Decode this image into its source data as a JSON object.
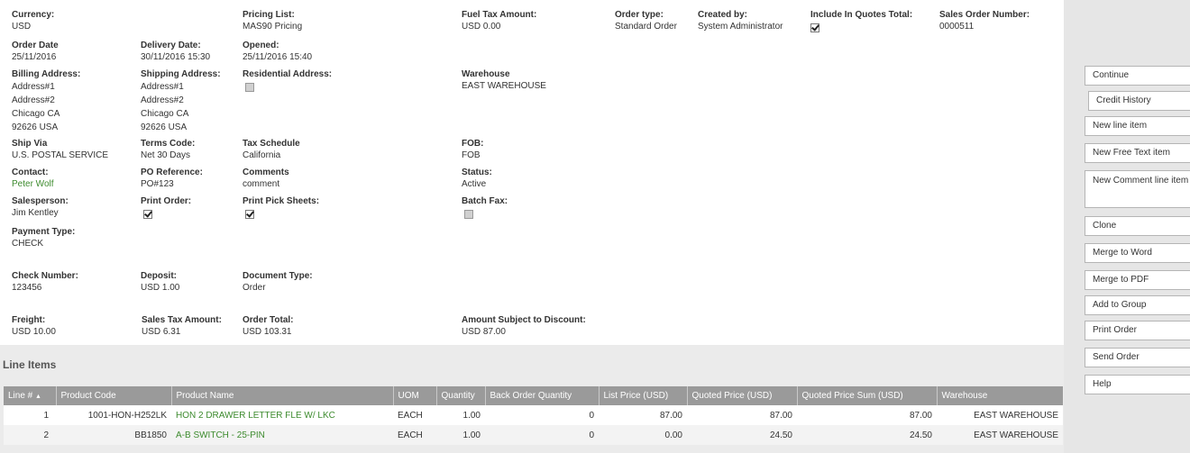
{
  "fields": {
    "currency": {
      "label": "Currency:",
      "value": "USD"
    },
    "pricing_list": {
      "label": "Pricing List:",
      "value": "MAS90 Pricing"
    },
    "fuel_tax": {
      "label": "Fuel Tax Amount:",
      "value": "USD 0.00"
    },
    "order_type": {
      "label": "Order type:",
      "value": "Standard Order"
    },
    "created_by": {
      "label": "Created by:",
      "value": "System Administrator"
    },
    "include_quotes": {
      "label": "Include In Quotes Total:",
      "checked": true
    },
    "sales_order_number": {
      "label": "Sales Order Number:",
      "value": "0000511"
    },
    "order_date": {
      "label": "Order Date",
      "value": "25/11/2016"
    },
    "delivery_date": {
      "label": "Delivery Date:",
      "value": "30/11/2016 15:30"
    },
    "opened": {
      "label": "Opened:",
      "value": "25/11/2016 15:40"
    },
    "billing_address": {
      "label": "Billing Address:",
      "lines": [
        "Address#1",
        "Address#2",
        "Chicago CA",
        "92626 USA"
      ]
    },
    "shipping_address": {
      "label": "Shipping Address:",
      "lines": [
        "Address#1",
        "Address#2",
        "Chicago CA",
        "92626 USA"
      ]
    },
    "residential_address": {
      "label": "Residential Address:",
      "checked": false
    },
    "warehouse": {
      "label": "Warehouse",
      "value": "EAST WAREHOUSE"
    },
    "ship_via": {
      "label": "Ship Via",
      "value": "U.S. POSTAL SERVICE"
    },
    "terms_code": {
      "label": "Terms Code:",
      "value": "Net 30 Days"
    },
    "tax_schedule": {
      "label": "Tax Schedule",
      "value": "California"
    },
    "fob": {
      "label": "FOB:",
      "value": "FOB"
    },
    "contact": {
      "label": "Contact:",
      "value": "Peter Wolf"
    },
    "po_reference": {
      "label": "PO Reference:",
      "value": "PO#123"
    },
    "comments": {
      "label": "Comments",
      "value": "comment"
    },
    "status": {
      "label": "Status:",
      "value": "Active"
    },
    "salesperson": {
      "label": "Salesperson:",
      "value": "Jim Kentley"
    },
    "print_order": {
      "label": "Print Order:",
      "checked": true
    },
    "print_pick_sheets": {
      "label": "Print Pick Sheets:",
      "checked": true
    },
    "batch_fax": {
      "label": "Batch Fax:",
      "checked": false
    },
    "payment_type": {
      "label": "Payment Type:",
      "value": "CHECK"
    },
    "check_number": {
      "label": "Check Number:",
      "value": "123456"
    },
    "deposit": {
      "label": "Deposit:",
      "value": "USD 1.00"
    },
    "document_type": {
      "label": "Document Type:",
      "value": "Order"
    },
    "freight": {
      "label": "Freight:",
      "value": "USD 10.00"
    },
    "sales_tax": {
      "label": "Sales Tax Amount:",
      "value": "USD 6.31"
    },
    "order_total": {
      "label": "Order Total:",
      "value": "USD 103.31"
    },
    "amount_subject_discount": {
      "label": "Amount Subject to Discount:",
      "value": "USD 87.00"
    }
  },
  "line_items": {
    "title": "Line Items",
    "sort_icon": "sort-asc-icon",
    "columns": [
      "Line #",
      "Product Code",
      "Product Name",
      "UOM",
      "Quantity",
      "Back Order Quantity",
      "List Price (USD)",
      "Quoted Price (USD)",
      "Quoted Price Sum (USD)",
      "Warehouse"
    ],
    "rows": [
      [
        "1",
        "1001-HON-H252LK",
        "HON 2 DRAWER LETTER FLE W/ LKC",
        "EACH",
        "1.00",
        "0",
        "87.00",
        "87.00",
        "87.00",
        "EAST WAREHOUSE"
      ],
      [
        "2",
        "BB1850",
        "A-B SWITCH - 25-PIN",
        "EACH",
        "1.00",
        "0",
        "0.00",
        "24.50",
        "24.50",
        "EAST WAREHOUSE"
      ]
    ]
  },
  "actions": {
    "continue": "Continue",
    "credit_history": "Credit History",
    "new_line_item": "New line item",
    "new_free_text_item": "New Free Text item",
    "new_comment_line_item": "New Comment line item",
    "clone": "Clone",
    "merge_to_word": "Merge to Word",
    "merge_to_pdf": "Merge to PDF",
    "add_to_group": "Add to Group",
    "print_order": "Print Order",
    "send_order": "Send Order",
    "help": "Help"
  },
  "colors": {
    "link": "#3d8b2e",
    "grid_header": "#9a9a9a"
  }
}
